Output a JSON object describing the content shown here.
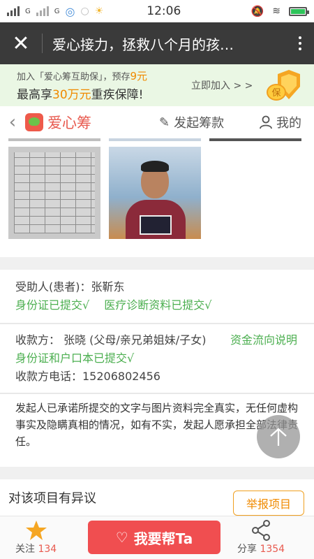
{
  "status_bar": {
    "time": "12:06",
    "signal_label_1": "G",
    "signal_label_2": "G"
  },
  "title_bar": {
    "title": "爱心接力，拯救八个月的孩…"
  },
  "promo": {
    "line1_prefix": "加入「爱心筹互助保」，预存",
    "line1_amount": "9元",
    "line2_prefix": "最高享",
    "line2_amount": "30万元",
    "line2_suffix": "重疾保障!",
    "cta": "立即加入 > >",
    "shield_text": "保"
  },
  "site_nav": {
    "logo_text": "爱心筹",
    "start_label": "发起筹款",
    "mine_label": "我的"
  },
  "recipient": {
    "line": "受助人(患者)：张靳东",
    "id_status": "身份证已提交√",
    "medical_status": "医疗诊断资料已提交√"
  },
  "payee": {
    "line": "收款方： 张晓 (父母/亲兄弟姐妹/子女)",
    "funds_link": "资金流向说明",
    "docs_status": "身份证和户口本已提交√",
    "phone": "收款方电话：15206802456"
  },
  "promise_text": "发起人已承诺所提交的文字与图片资料完全真实，无任何虚构事实及隐瞒真相的情况，如有不实，发起人愿承担全部法律责任。",
  "dispute": {
    "label": "对该项目有异议",
    "report_button": "举报项目"
  },
  "bottom_bar": {
    "follow_label": "关注",
    "follow_count": "134",
    "help_button": "我要帮Ta",
    "share_label": "分享",
    "share_count": "1354"
  },
  "colors": {
    "accent_red": "#f04e50",
    "green": "#4caf50",
    "orange": "#f08a00",
    "titlebar": "#3a3a3a"
  }
}
